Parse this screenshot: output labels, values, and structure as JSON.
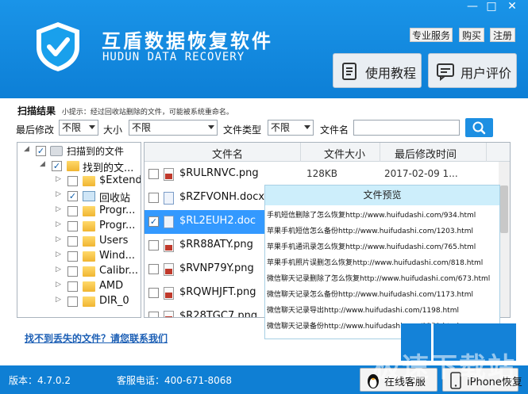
{
  "header": {
    "title": "互盾数据恢复软件",
    "subtitle": "HUDUN DATA RECOVERY",
    "links": {
      "service": "专业服务",
      "buy": "购买",
      "register": "注册"
    },
    "window_controls": {
      "minimize": "—",
      "maximize": "□",
      "close": "✕"
    },
    "buttons": {
      "tutorial": "使用教程",
      "review": "用户评价"
    }
  },
  "hint": {
    "label": "扫描结果",
    "text": "小提示：经过回收站删除的文件，可能被系统重命名。"
  },
  "filters": {
    "modified_label": "最后修改",
    "modified_value": "不限",
    "size_label": "大小",
    "size_value": "不限",
    "filetype_label": "文件类型",
    "filetype_value": "不限",
    "filename_label": "文件名",
    "filename_value": ""
  },
  "tree": {
    "root": {
      "label": "扫描到的文件",
      "checked": true
    },
    "found": {
      "label": "找到的文...",
      "checked": true
    },
    "children": [
      {
        "label": "$Extend",
        "checked": false
      },
      {
        "label": "回收站",
        "checked": true
      },
      {
        "label": "Progr...",
        "checked": false
      },
      {
        "label": "Progr...",
        "checked": false
      },
      {
        "label": "Users",
        "checked": false
      },
      {
        "label": "Wind...",
        "checked": false
      },
      {
        "label": "Calibr...",
        "checked": false
      },
      {
        "label": "AMD",
        "checked": false
      },
      {
        "label": "DIR_0",
        "checked": false
      }
    ]
  },
  "file_list": {
    "columns": {
      "name": "文件名",
      "size": "文件大小",
      "date": "最后修改时间"
    },
    "rows": [
      {
        "name": "$RULRNVC.png",
        "size": "128KB",
        "date": "2017-02-09 1...",
        "checked": false,
        "selected": false,
        "type": "png"
      },
      {
        "name": "$RZFVONH.docx",
        "size": "",
        "date": "",
        "checked": false,
        "selected": false,
        "type": "docx"
      },
      {
        "name": "$RL2EUH2.doc",
        "size": "",
        "date": "",
        "checked": true,
        "selected": true,
        "type": "doc"
      },
      {
        "name": "$RR88ATY.png",
        "size": "",
        "date": "",
        "checked": false,
        "selected": false,
        "type": "png"
      },
      {
        "name": "$RVNP79Y.png",
        "size": "",
        "date": "",
        "checked": false,
        "selected": false,
        "type": "png"
      },
      {
        "name": "$RQWHJFT.png",
        "size": "",
        "date": "",
        "checked": false,
        "selected": false,
        "type": "png"
      },
      {
        "name": "$R28TGC7.png",
        "size": "",
        "date": "",
        "checked": false,
        "selected": false,
        "type": "png"
      }
    ]
  },
  "preview": {
    "title": "文件预览",
    "lines": [
      "手机短信删除了怎么恢复http://www.huifudashi.com/934.html",
      "苹果手机短信怎么备份http://www.huifudashi.com/1203.html",
      "苹果手机通讯录怎么恢复http://www.huifudashi.com/765.html",
      "苹果手机照片误删怎么恢复http://www.huifudashi.com/818.html",
      "微信聊天记录删除了怎么恢复http://www.huifudashi.com/673.html",
      "微信聊天记录怎么备份http://www.huifudashi.com/1173.html",
      "微信聊天记录导出http://www.huifudashi.com/1198.html",
      "微信聊天记录备份http://www.huifudashi.com/1251.html"
    ]
  },
  "footer": {
    "help_link": "找不到丢失的文件？请您联系我们",
    "version": "版本：4.7.0.2",
    "hotline": "客服电话：400-671-8068",
    "online_service": "在线客服",
    "iphone_recover": "iPhone恢复",
    "watermark": "极速下载站"
  },
  "colors": {
    "header_blue": "#1a94e8",
    "status_blue": "#0f7fd4",
    "selection_blue": "#3399ff",
    "preview_title_bg": "#cdeefb",
    "link_blue": "#1c5fb5"
  }
}
